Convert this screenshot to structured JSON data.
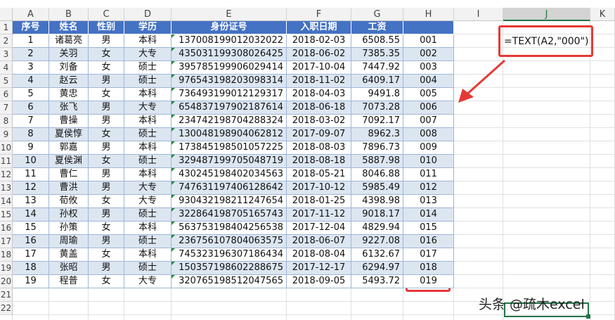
{
  "columns": [
    "A",
    "B",
    "C",
    "D",
    "E",
    "F",
    "G",
    "H",
    "I",
    "J",
    "K"
  ],
  "selected_column": "J",
  "row_numbers": [
    "1",
    "2",
    "3",
    "4",
    "5",
    "6",
    "7",
    "8",
    "9",
    "10",
    "11",
    "12",
    "13",
    "14",
    "15",
    "16",
    "17",
    "18",
    "19",
    "20",
    "21",
    "22"
  ],
  "table": {
    "headers": [
      "序号",
      "姓名",
      "性别",
      "学历",
      "身份证号",
      "入职日期",
      "工资",
      ""
    ],
    "rows": [
      [
        "1",
        "诸葛亮",
        "男",
        "本科",
        "137008199012032022",
        "2018-02-03",
        "6508.55",
        "001"
      ],
      [
        "2",
        "关羽",
        "女",
        "大专",
        "435031199308026425",
        "2018-06-02",
        "7385.35",
        "002"
      ],
      [
        "3",
        "刘备",
        "女",
        "硕士",
        "395785199906029414",
        "2017-10-04",
        "7447.92",
        "003"
      ],
      [
        "4",
        "赵云",
        "男",
        "硕士",
        "976543198203098314",
        "2018-11-02",
        "6409.17",
        "004"
      ],
      [
        "5",
        "黄忠",
        "女",
        "本科",
        "736493199012129317",
        "2018-04-03",
        "9491.8",
        "005"
      ],
      [
        "6",
        "张飞",
        "男",
        "大专",
        "654837197902187614",
        "2018-06-18",
        "7073.28",
        "006"
      ],
      [
        "7",
        "曹操",
        "男",
        "本科",
        "234742198704288324",
        "2018-03-02",
        "7092.17",
        "007"
      ],
      [
        "8",
        "夏侯惇",
        "女",
        "硕士",
        "130048198904062812",
        "2017-09-07",
        "8962.3",
        "008"
      ],
      [
        "9",
        "郭嘉",
        "男",
        "本科",
        "173845198501057225",
        "2018-08-03",
        "7896.73",
        "009"
      ],
      [
        "10",
        "夏侯渊",
        "女",
        "硕士",
        "329487199705048719",
        "2018-08-18",
        "5887.98",
        "010"
      ],
      [
        "11",
        "曹仁",
        "男",
        "本科",
        "430245198402034563",
        "2018-05-21",
        "8046.88",
        "011"
      ],
      [
        "12",
        "曹洪",
        "男",
        "大专",
        "747631197406128642",
        "2017-10-12",
        "5985.49",
        "012"
      ],
      [
        "13",
        "荀攸",
        "女",
        "大专",
        "930432198211247654",
        "2018-01-25",
        "4398.98",
        "013"
      ],
      [
        "14",
        "孙权",
        "男",
        "硕士",
        "322864198705165743",
        "2017-11-12",
        "9018.17",
        "014"
      ],
      [
        "15",
        "孙策",
        "女",
        "本科",
        "563753198404256538",
        "2017-12-04",
        "4829.94",
        "015"
      ],
      [
        "16",
        "周瑜",
        "男",
        "硕士",
        "236756107804063575",
        "2018-06-07",
        "9227.08",
        "016"
      ],
      [
        "17",
        "黄盖",
        "女",
        "本科",
        "745323196307186434",
        "2018-08-04",
        "6132.67",
        "017"
      ],
      [
        "18",
        "张昭",
        "男",
        "硕士",
        "150357198602288675",
        "2017-12-17",
        "6294.97",
        "018"
      ],
      [
        "19",
        "程普",
        "女",
        "大专",
        "320765198512047565",
        "2018-09-05",
        "5493.72",
        "019"
      ]
    ]
  },
  "formula": "=TEXT(A2,\"000\")",
  "watermark": "头条 @疏木excel",
  "colors": {
    "header_bg": "#4472c4",
    "band_bg": "#dce6f1",
    "annotation": "#e53935",
    "excel_green": "#217346"
  }
}
